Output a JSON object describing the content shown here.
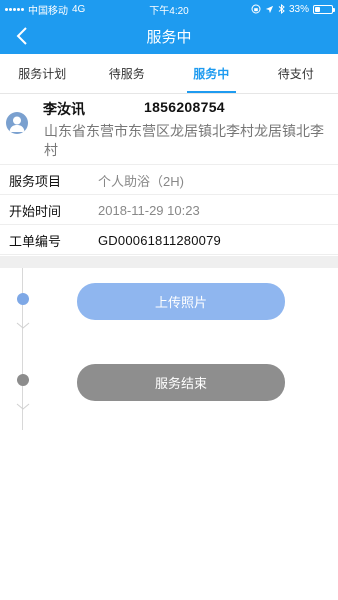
{
  "status_bar": {
    "carrier": "中国移动",
    "network": "4G",
    "time": "下午4:20",
    "battery_percent": "33%",
    "battery_level": 0.33
  },
  "nav": {
    "title": "服务中",
    "back_icon": "chevron-left-icon"
  },
  "tabs": [
    {
      "label": "服务计划",
      "active": false
    },
    {
      "label": "待服务",
      "active": false
    },
    {
      "label": "服务中",
      "active": true
    },
    {
      "label": "待支付",
      "active": false
    }
  ],
  "customer": {
    "name": "李汝讯",
    "phone": "1856208754",
    "address": "山东省东营市东营区龙居镇北李村龙居镇北李村"
  },
  "details": [
    {
      "label": "服务项目",
      "value": "个人助浴（2H)"
    },
    {
      "label": "开始时间",
      "value": "2018-11-29 10:23"
    },
    {
      "label": "工单编号",
      "value": "GD00061811280079"
    }
  ],
  "actions": {
    "upload_photo": "上传照片",
    "finish_service": "服务结束"
  },
  "colors": {
    "primary": "#1e9bf0",
    "upload_button": "#8fb6ef",
    "finish_button": "#8e8e8e",
    "step_dot_active": "#7ea8e6",
    "step_dot_inactive": "#8c8c8c"
  }
}
